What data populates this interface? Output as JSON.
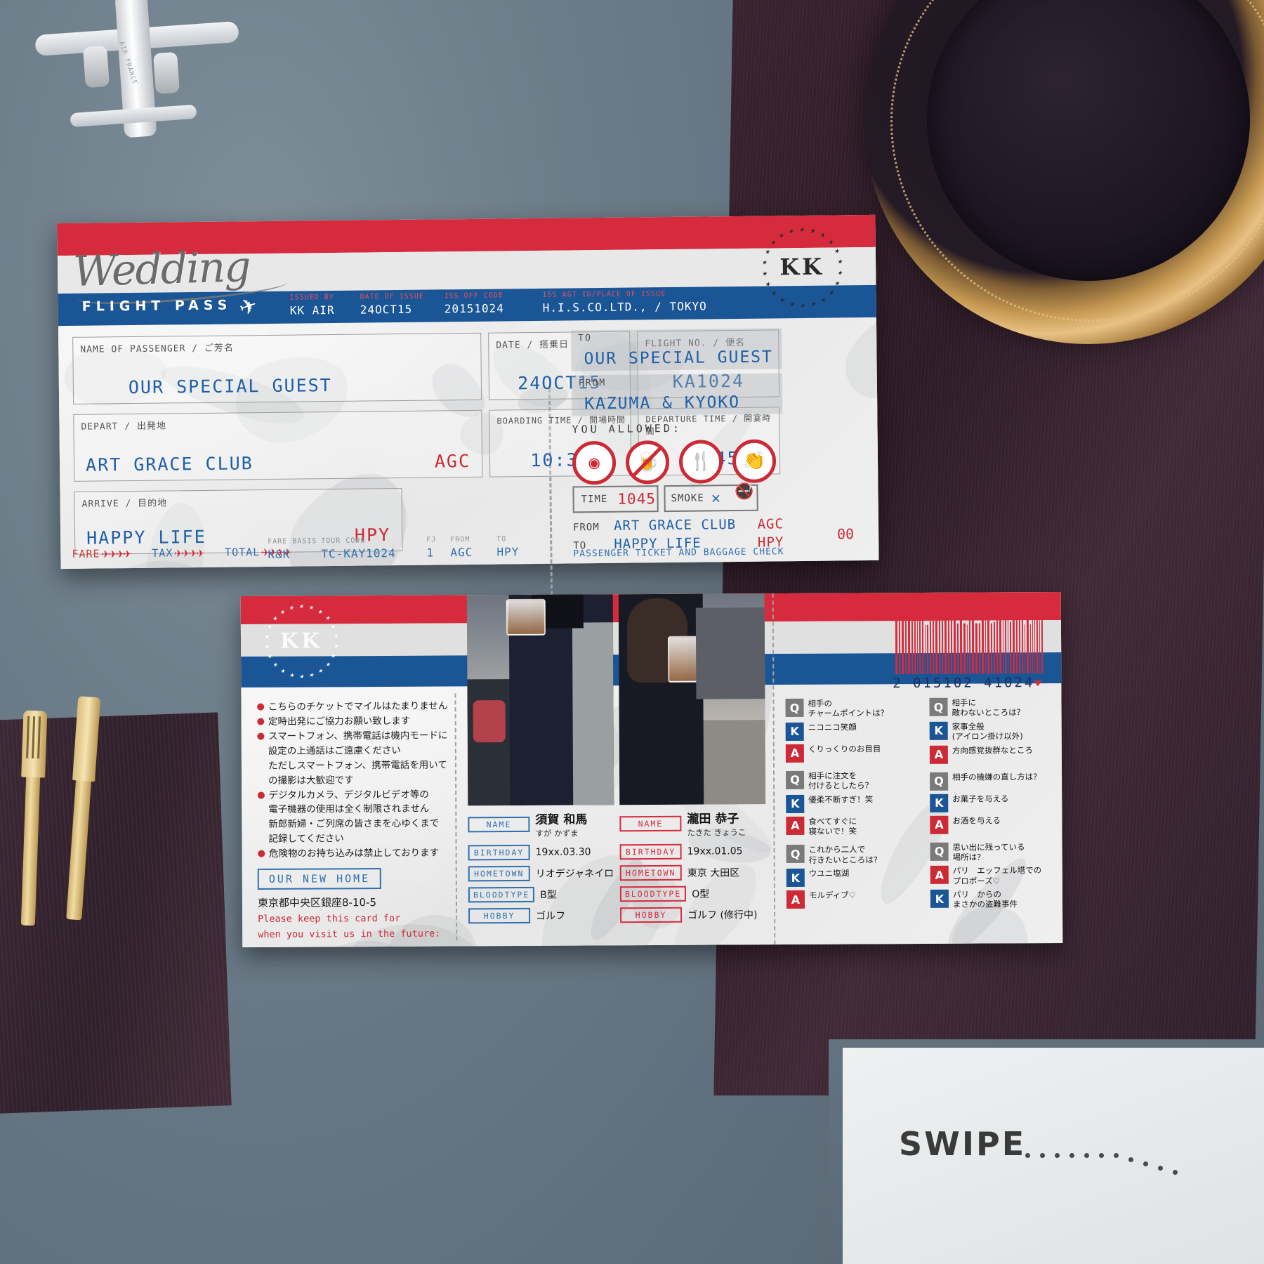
{
  "scene": {
    "swipe_label": "SWIPE",
    "plane_text": "AIR FRANCE"
  },
  "top_ticket": {
    "title_script": "Wedding",
    "subtitle": "FLIGHT PASS",
    "stamp_initials": "KK",
    "issue_headers": [
      "ISSUED BY",
      "DATE OF ISSUE",
      "ISS OFF CODE",
      "ISS AGT ID/PLACE OF ISSUE"
    ],
    "issue_values": [
      "KK AIR",
      "24OCT15",
      "20151024",
      "H.I.S.CO.LTD., / TOKYO"
    ],
    "fields": {
      "name_label": "NAME OF PASSENGER / ご芳名",
      "name_value": "OUR SPECIAL GUEST",
      "date_label": "DATE / 搭乗日",
      "date_value": "24OCT15",
      "flight_label": "FLIGHT NO. / 便名",
      "flight_value": "KA1024",
      "depart_label": "DEPART / 出発地",
      "depart_value": "ART GRACE CLUB",
      "depart_code": "AGC",
      "boarding_label": "BOARDING TIME / 開場時間",
      "boarding_value": "10:30",
      "departure_label": "DEPARTURE TIME / 開宴時間",
      "departure_value": "10:45",
      "arrive_label": "ARRIVE / 目的地",
      "arrive_value": "HAPPY LIFE",
      "arrive_code": "HPY"
    },
    "fare_row": {
      "fare_label": "FARE",
      "tax_label": "TAX",
      "total_label": "TOTAL",
      "planes": "✈✈✈✈"
    },
    "basis": {
      "headers": [
        "FARE BASIS",
        "TOUR CODE",
        "FJ",
        "FROM",
        "TO"
      ],
      "values": [
        "K&K",
        "TC-KAY1024",
        "1",
        "AGC",
        "HPY"
      ]
    },
    "stub": {
      "to_label": "TO",
      "to_value": "OUR SPECIAL GUEST",
      "from_label": "FROM",
      "from_value": "KAZUMA & KYOKO",
      "allowed_label": "YOU ALLOWED:",
      "icons": [
        "camera-icon",
        "drink-icon",
        "cutlery-icon",
        "applause-icon"
      ],
      "time_label": "TIME",
      "time_value": "1045",
      "smoke_label": "SMOKE",
      "smoke_value": "✕",
      "from_row_label": "FROM",
      "from_row_value": "ART GRACE CLUB",
      "from_row_code": "AGC",
      "to_row_label": "TO",
      "to_row_value": "HAPPY LIFE",
      "to_row_code": "HPY",
      "footer": "PASSENGER TICKET AND BAGGAGE CHECK",
      "footer_code": "00"
    }
  },
  "bottom_ticket": {
    "stamp_initials": "KK",
    "barcode_number": "2  015102 41024",
    "notes": [
      {
        "bullet": true,
        "text": "こちらのチケットでマイルはたまりません"
      },
      {
        "bullet": true,
        "text": "定時出発にご協力お願い致します"
      },
      {
        "bullet": true,
        "text": "スマートフォン、携帯電話は機内モードに"
      },
      {
        "bullet": false,
        "text": "設定の上通話はご遠慮ください"
      },
      {
        "bullet": false,
        "text": "ただしスマートフォン、携帯電話を用いて"
      },
      {
        "bullet": false,
        "text": "の撮影は大歓迎です"
      },
      {
        "bullet": true,
        "text": "デジタルカメラ、デジタルビデオ等の"
      },
      {
        "bullet": false,
        "text": "電子機器の使用は全く制限されません"
      },
      {
        "bullet": false,
        "text": "新郎新婦・ご列席の皆さまを心ゆくまで"
      },
      {
        "bullet": false,
        "text": "記録してください"
      },
      {
        "bullet": true,
        "text": "危険物のお持ち込みは禁止しております"
      }
    ],
    "new_home_label": "OUR NEW HOME",
    "address": "東京都中央区銀座8-10-5",
    "keep_note_1": "Please keep this card for",
    "keep_note_2": "when you visit us in the future:",
    "profiles": [
      {
        "accent": "#2f6fb0",
        "rows": [
          {
            "tag": "NAME",
            "value": "須賀 和馬",
            "kana": "すが かずま"
          },
          {
            "tag": "BIRTHDAY",
            "value": "19xx.03.30"
          },
          {
            "tag": "HOMETOWN",
            "value": "リオデジャネイロ"
          },
          {
            "tag": "BLOODTYPE",
            "value": "B型"
          },
          {
            "tag": "HOBBY",
            "value": "ゴルフ"
          }
        ]
      },
      {
        "accent": "#d62b3d",
        "rows": [
          {
            "tag": "NAME",
            "value": "瀧田 恭子",
            "kana": "たきた きょうこ"
          },
          {
            "tag": "BIRTHDAY",
            "value": "19xx.01.05"
          },
          {
            "tag": "HOMETOWN",
            "value": "東京 大田区"
          },
          {
            "tag": "BLOODTYPE",
            "value": "O型"
          },
          {
            "tag": "HOBBY",
            "value": "ゴルフ (修行中)"
          }
        ]
      }
    ],
    "qa_columns": [
      {
        "groups": [
          {
            "q": "相手の\nチャームポイントは？",
            "k": "ニコニコ笑顔",
            "a": "くりっくりのお目目"
          },
          {
            "q": "相手に注文を\n付けるとしたら？",
            "k": "優柔不断すぎ！笑",
            "a": "食べてすぐに\n寝ないで！笑"
          },
          {
            "q": "これから二人で\n行きたいところは？",
            "k": "ウユニ塩湖",
            "a": "モルディブ♡"
          }
        ]
      },
      {
        "groups": [
          {
            "q": "相手に\n敵わないところは？",
            "k": "家事全般\n(アイロン掛け以外)",
            "a": "方向感覚抜群なところ"
          },
          {
            "q": "相手の機嫌の直し方は？",
            "k": "お菓子を与える",
            "a": "お酒を与える"
          },
          {
            "q": "思い出に残っている\n場所は？",
            "a": "パリ　エッフェル塔での\nプロポーズ♡",
            "k": "パリ　からの\nまさかの盗難事件",
            "order": "qak"
          }
        ]
      }
    ]
  }
}
